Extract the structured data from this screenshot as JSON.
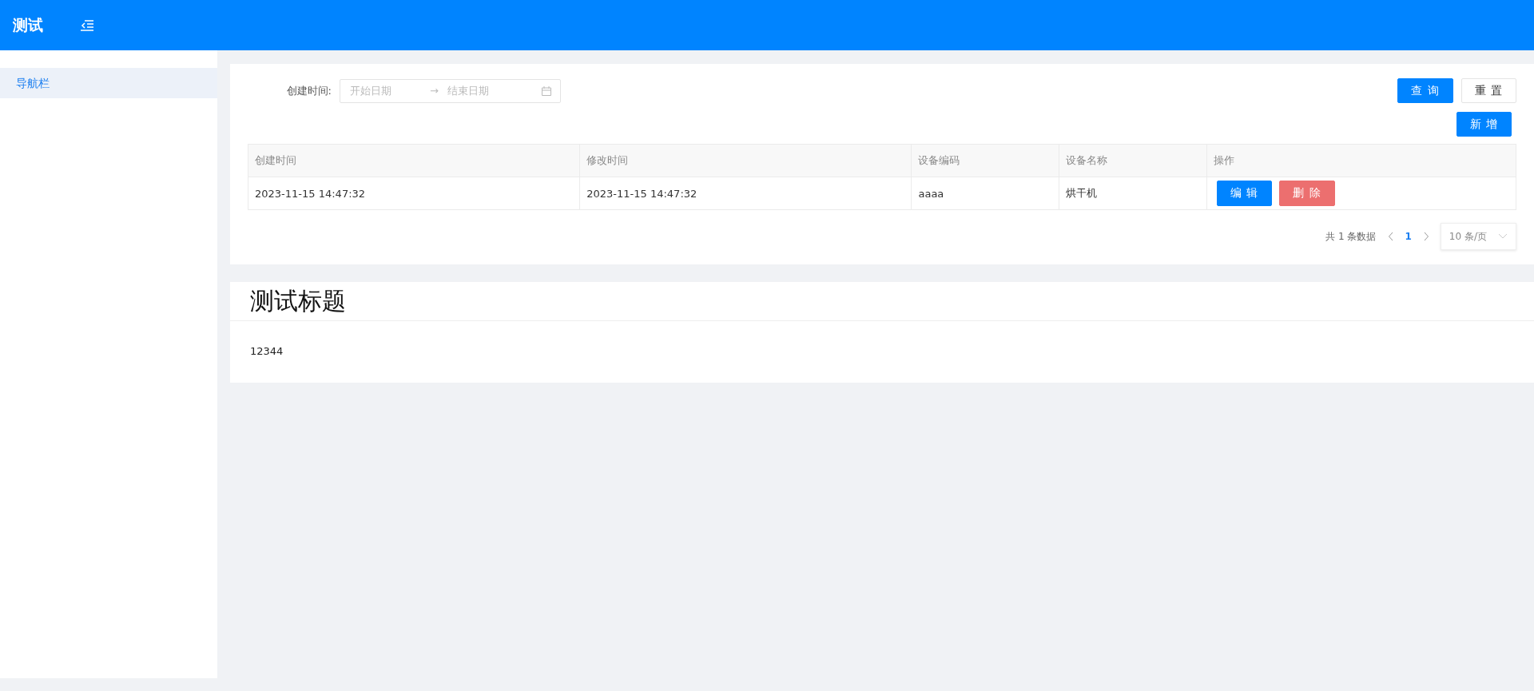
{
  "header": {
    "title": "测试"
  },
  "sidebar": {
    "items": [
      {
        "label": "导航栏",
        "selected": true
      }
    ]
  },
  "filter": {
    "label": "创建时间:",
    "start_placeholder": "开始日期",
    "separator": "→",
    "end_placeholder": "结束日期",
    "buttons": [
      {
        "label": "查 询",
        "kind": "primary"
      },
      {
        "label": "重 置",
        "kind": "default"
      }
    ],
    "add_button": {
      "label": "新 增",
      "kind": "primary"
    }
  },
  "table": {
    "columns": [
      "创建时间",
      "修改时间",
      "设备编码",
      "设备名称",
      "操作"
    ],
    "rows": [
      {
        "cells": [
          "2023-11-15 14:47:32",
          "2023-11-15 14:47:32",
          "aaaa",
          "烘干机"
        ],
        "actions": [
          {
            "label": "编 辑",
            "kind": "primary"
          },
          {
            "label": "删 除",
            "kind": "danger"
          }
        ]
      }
    ]
  },
  "pagination": {
    "total": "共 1 条数据",
    "pages": [
      {
        "label": "1",
        "selected": true
      }
    ],
    "page_size": "10 条/页"
  },
  "section": {
    "title": "测试标题",
    "body": "12344"
  }
}
